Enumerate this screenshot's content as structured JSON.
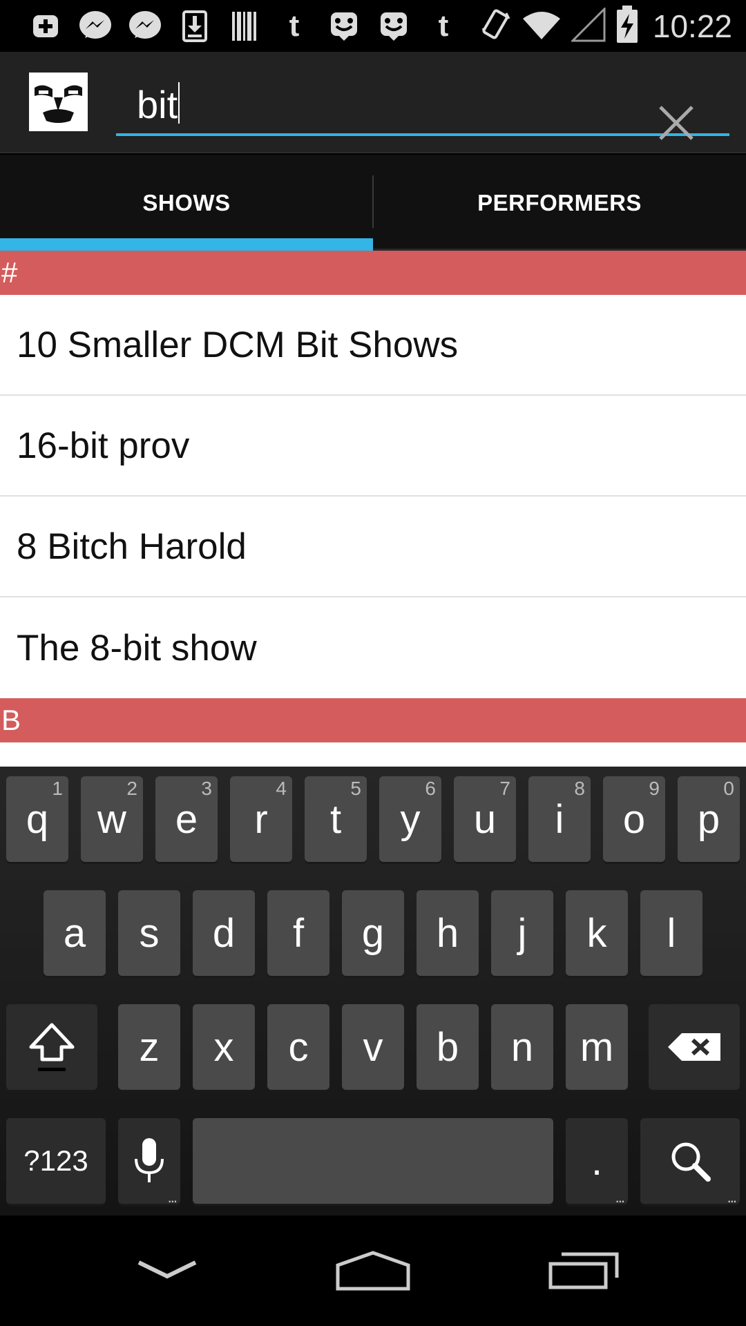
{
  "status_bar": {
    "time": "10:22",
    "notification_icons": [
      "add-icon",
      "messenger-icon",
      "messenger-icon",
      "download-icon",
      "barcode-icon",
      "tumblr-icon",
      "groupme-icon",
      "groupme-icon",
      "tumblr-icon"
    ],
    "status_icons": [
      "vibrate-icon",
      "wifi-icon",
      "signal-icon",
      "battery-charging-icon"
    ],
    "notif_glyphs": {
      "tumblr": "t"
    }
  },
  "action_bar": {
    "search_value": "bit"
  },
  "tabs": [
    {
      "label": "SHOWS",
      "selected": true
    },
    {
      "label": "PERFORMERS",
      "selected": false
    }
  ],
  "list": {
    "sections": [
      {
        "header": "#",
        "items": [
          "10 Smaller DCM Bit Shows",
          "16-bit prov",
          "8 Bitch Harold",
          "The 8-bit show"
        ]
      },
      {
        "header": "B",
        "items": []
      }
    ]
  },
  "keyboard": {
    "row1": [
      {
        "key": "q",
        "hint": "1"
      },
      {
        "key": "w",
        "hint": "2"
      },
      {
        "key": "e",
        "hint": "3"
      },
      {
        "key": "r",
        "hint": "4"
      },
      {
        "key": "t",
        "hint": "5"
      },
      {
        "key": "y",
        "hint": "6"
      },
      {
        "key": "u",
        "hint": "7"
      },
      {
        "key": "i",
        "hint": "8"
      },
      {
        "key": "o",
        "hint": "9"
      },
      {
        "key": "p",
        "hint": "0"
      }
    ],
    "row2": [
      "a",
      "s",
      "d",
      "f",
      "g",
      "h",
      "j",
      "k",
      "l"
    ],
    "row3": [
      "z",
      "x",
      "c",
      "v",
      "b",
      "n",
      "m"
    ],
    "symbols_label": "?123",
    "period_label": "."
  },
  "colors": {
    "accent": "#33b5e5",
    "section_header": "#d45c5c",
    "action_bar": "#222222",
    "key": "#4a4a4a"
  }
}
